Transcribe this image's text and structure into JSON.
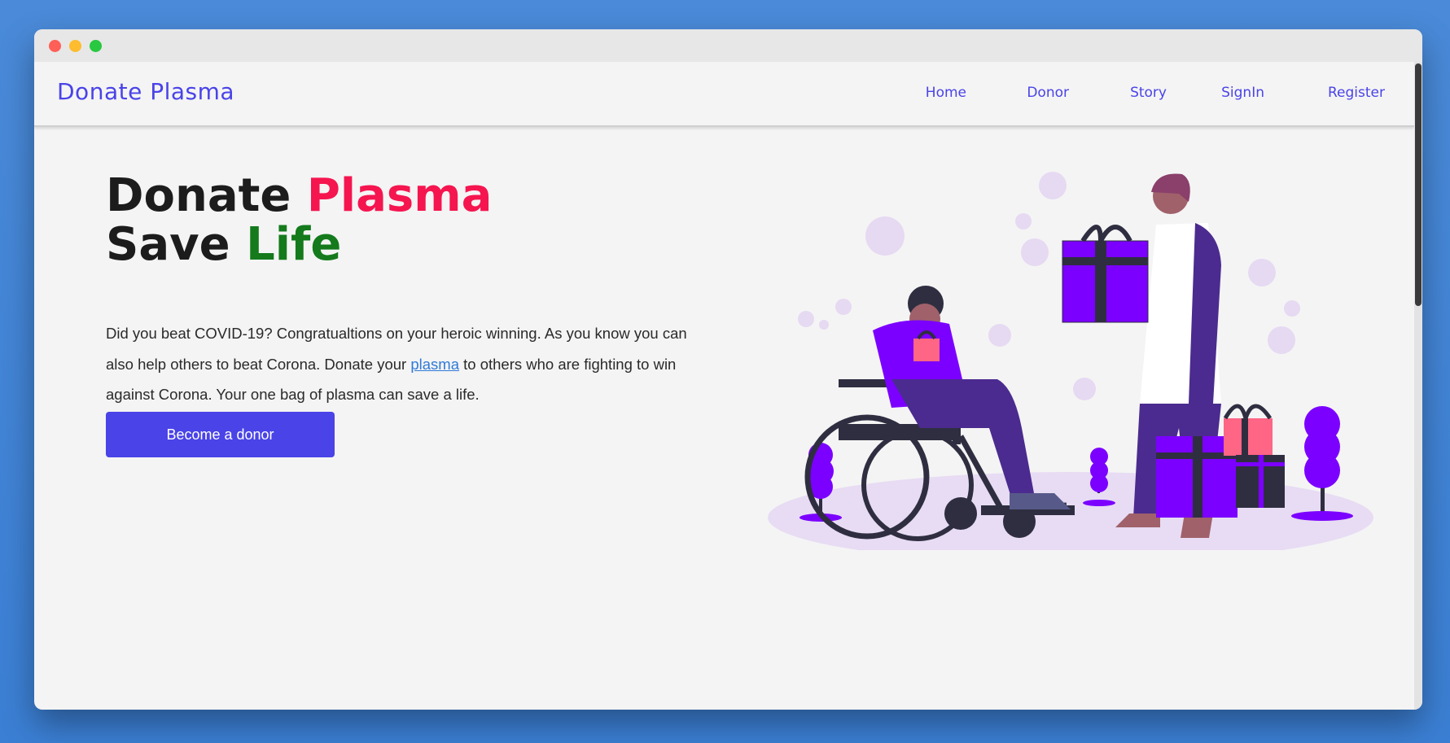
{
  "brand": {
    "name": "Donate Plasma"
  },
  "nav": {
    "home": "Home",
    "donor": "Donor",
    "story": "Story",
    "signin": "SignIn",
    "register": "Register"
  },
  "hero": {
    "line1_a": "Donate",
    "line1_b": "Plasma",
    "line2_a": "Save",
    "line2_b": "Life",
    "text_before": "Did you beat COVID-19? Congratualtions on your heroic winning. As you know you can also help others to beat Corona. Donate your ",
    "link": "plasma",
    "text_after": " to others who are fighting to win against Corona. Your one bag of plasma can save a life.",
    "cta": "Become a donor"
  },
  "colors": {
    "accent": "#4a43e8",
    "plasma": "#f5154f",
    "life": "#147a1c",
    "illustration_purple": "#7b00ff"
  }
}
